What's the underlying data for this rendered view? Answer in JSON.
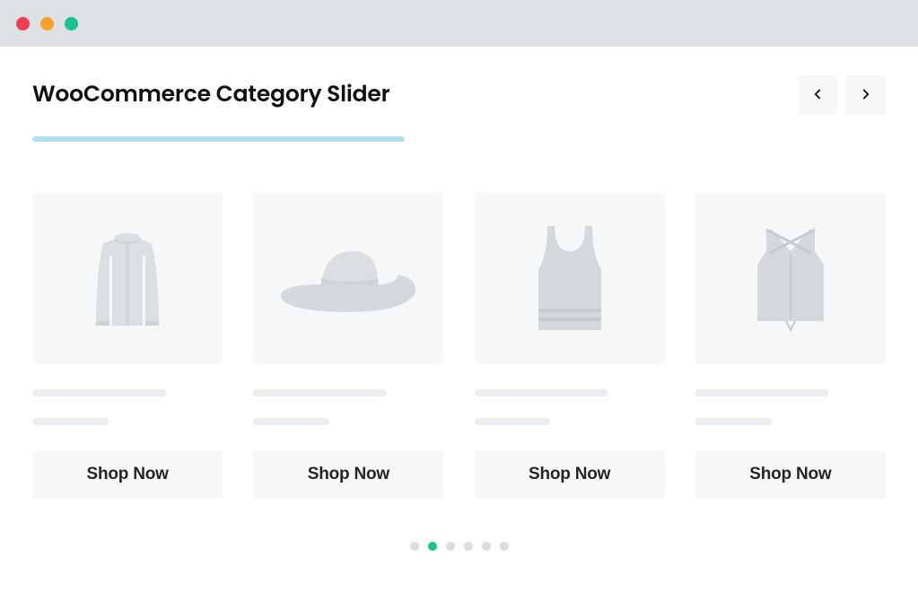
{
  "header": {
    "title": "WooCommerce Category Slider"
  },
  "nav": {
    "prev_label": "Previous",
    "next_label": "Next"
  },
  "cards": [
    {
      "icon": "jacket-icon",
      "cta_label": "Shop Now"
    },
    {
      "icon": "hat-icon",
      "cta_label": "Shop Now"
    },
    {
      "icon": "tanktop-icon",
      "cta_label": "Shop Now"
    },
    {
      "icon": "croptop-icon",
      "cta_label": "Shop Now"
    }
  ],
  "pagination": {
    "count": 6,
    "active_index": 1
  },
  "colors": {
    "accent": "#17c48c",
    "underline": "#b0dfef",
    "panel": "#f6f7f9",
    "skeleton": "#eaedef"
  }
}
